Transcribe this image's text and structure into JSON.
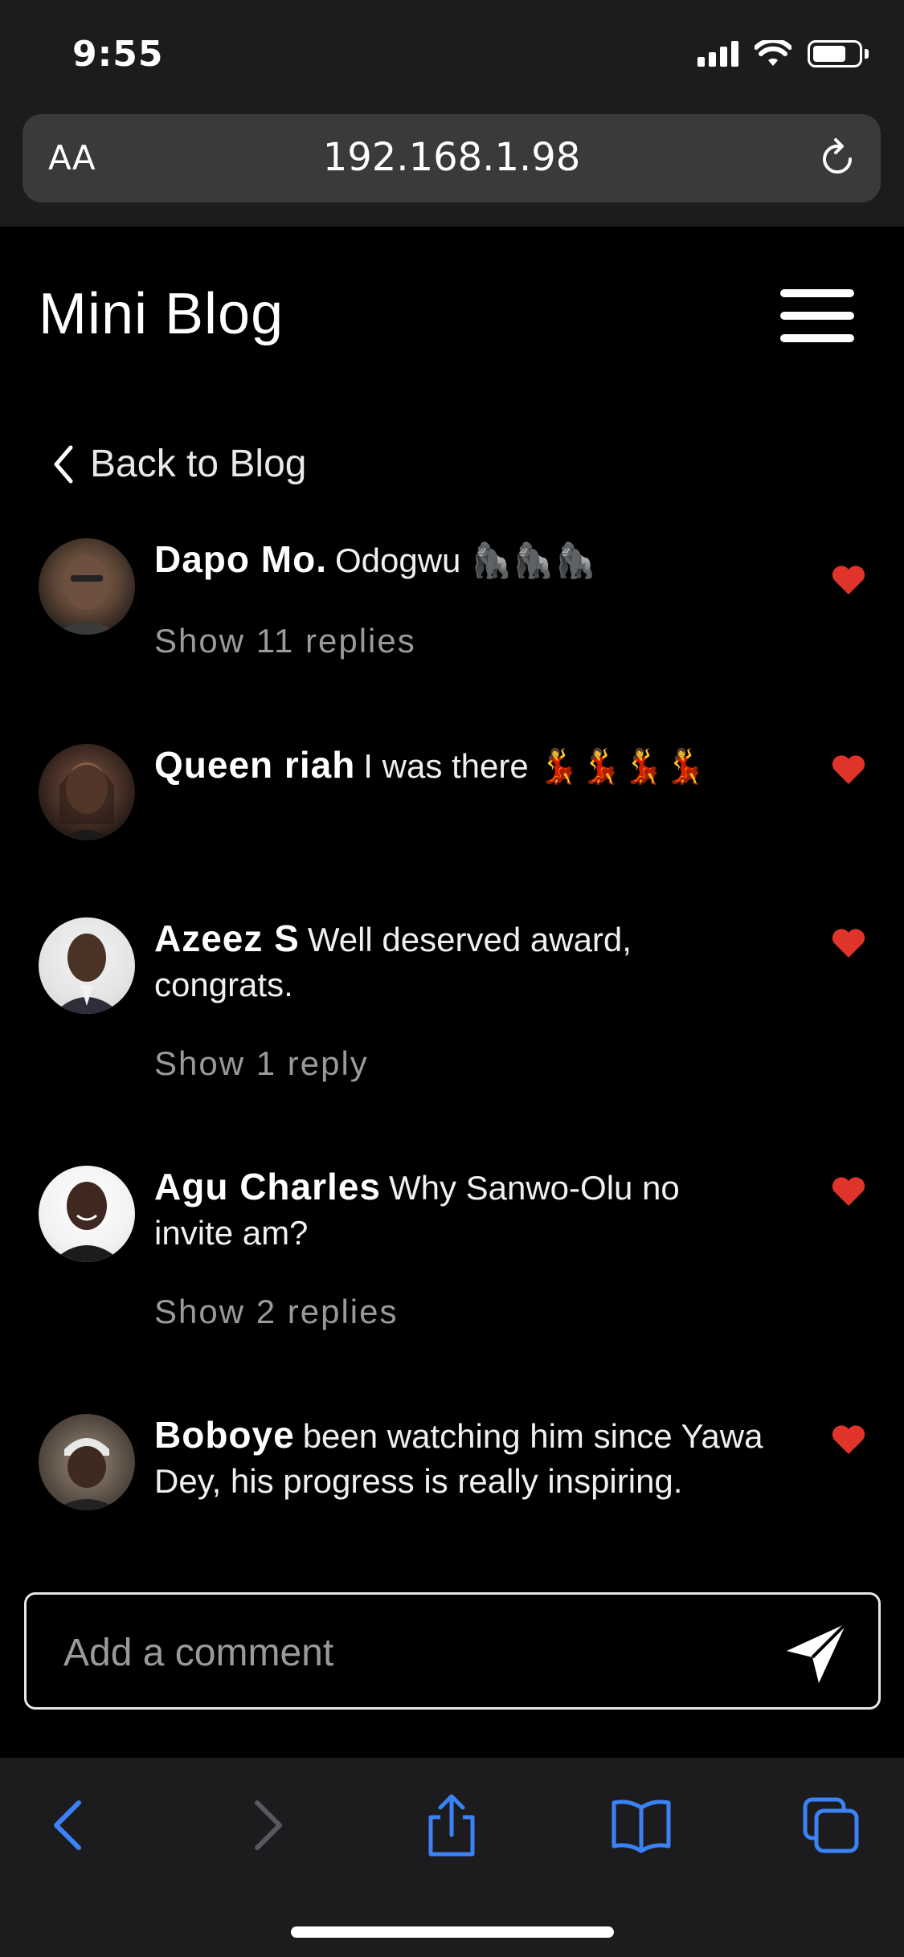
{
  "status_bar": {
    "time": "9:55"
  },
  "browser": {
    "text_size_label": "AA",
    "url": "192.168.1.98"
  },
  "blog": {
    "title": "Mini Blog"
  },
  "nav": {
    "back_label": "Back to Blog"
  },
  "comments": [
    {
      "author": "Dapo Mo.",
      "text": "Odogwu",
      "emoji": "🦍🦍🦍",
      "liked": true,
      "replies": "Show 11 replies"
    },
    {
      "author": "Queen riah",
      "text": "I was there",
      "emoji": "💃💃💃💃",
      "liked": true,
      "replies": ""
    },
    {
      "author": "Azeez S",
      "text": "Well deserved award, congrats.",
      "emoji": "",
      "liked": true,
      "replies": "Show 1 reply"
    },
    {
      "author": "Agu Charles",
      "text": "Why Sanwo-Olu no invite am?",
      "emoji": "",
      "liked": true,
      "replies": "Show 2 replies"
    },
    {
      "author": "Boboye",
      "text": "been watching him since Yawa Dey, his progress is really inspiring.",
      "emoji": "",
      "liked": true,
      "replies": ""
    }
  ],
  "comment_form": {
    "placeholder": "Add a comment"
  },
  "colors": {
    "heart": "#e0342b",
    "safari_blue": "#3b82f6",
    "chrome_bg": "#1c1c1e",
    "page_bg": "#000000"
  },
  "icons": {
    "reload": "reload-icon",
    "menu": "hamburger-menu-icon",
    "back": "chevron-left-icon",
    "like": "heart-icon",
    "send": "send-icon",
    "toolbar": [
      "back-arrow-icon",
      "forward-arrow-icon",
      "share-icon",
      "bookmarks-icon",
      "tabs-icon"
    ]
  }
}
